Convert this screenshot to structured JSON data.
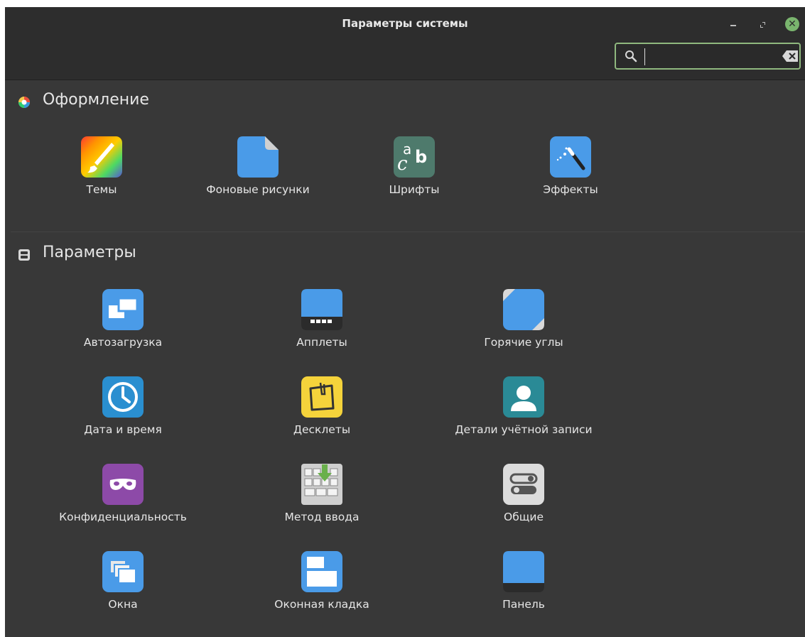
{
  "window": {
    "title": "Параметры системы",
    "close_glyph": "✕"
  },
  "search": {
    "value": "",
    "placeholder": ""
  },
  "sections": {
    "appearance": {
      "title": "Оформление",
      "items": [
        {
          "label": "Темы",
          "icon": "themes-icon"
        },
        {
          "label": "Фоновые рисунки",
          "icon": "backgrounds-icon"
        },
        {
          "label": "Шрифты",
          "icon": "fonts-icon"
        },
        {
          "label": "Эффекты",
          "icon": "effects-icon"
        }
      ]
    },
    "preferences": {
      "title": "Параметры",
      "items": [
        {
          "label": "Автозагрузка",
          "icon": "startup-icon"
        },
        {
          "label": "Апплеты",
          "icon": "applets-icon"
        },
        {
          "label": "Горячие углы",
          "icon": "hot-corners-icon"
        },
        {
          "label": "Дата и время",
          "icon": "clock-icon"
        },
        {
          "label": "Десклеты",
          "icon": "desklets-icon"
        },
        {
          "label": "Детали учётной записи",
          "icon": "user-icon"
        },
        {
          "label": "Конфиденциальность",
          "icon": "mask-icon"
        },
        {
          "label": "Метод ввода",
          "icon": "keyboard-icon"
        },
        {
          "label": "Общие",
          "icon": "toggles-icon"
        },
        {
          "label": "Окна",
          "icon": "windows-icon"
        },
        {
          "label": "Оконная кладка",
          "icon": "window-tiling-icon"
        },
        {
          "label": "Панель",
          "icon": "panel-icon"
        }
      ]
    }
  },
  "colors": {
    "window_bg": "#383838",
    "titlebar_bg": "#2d2d2d",
    "accent_green": "#8fb87e",
    "icon_blue": "#4a9be8"
  }
}
